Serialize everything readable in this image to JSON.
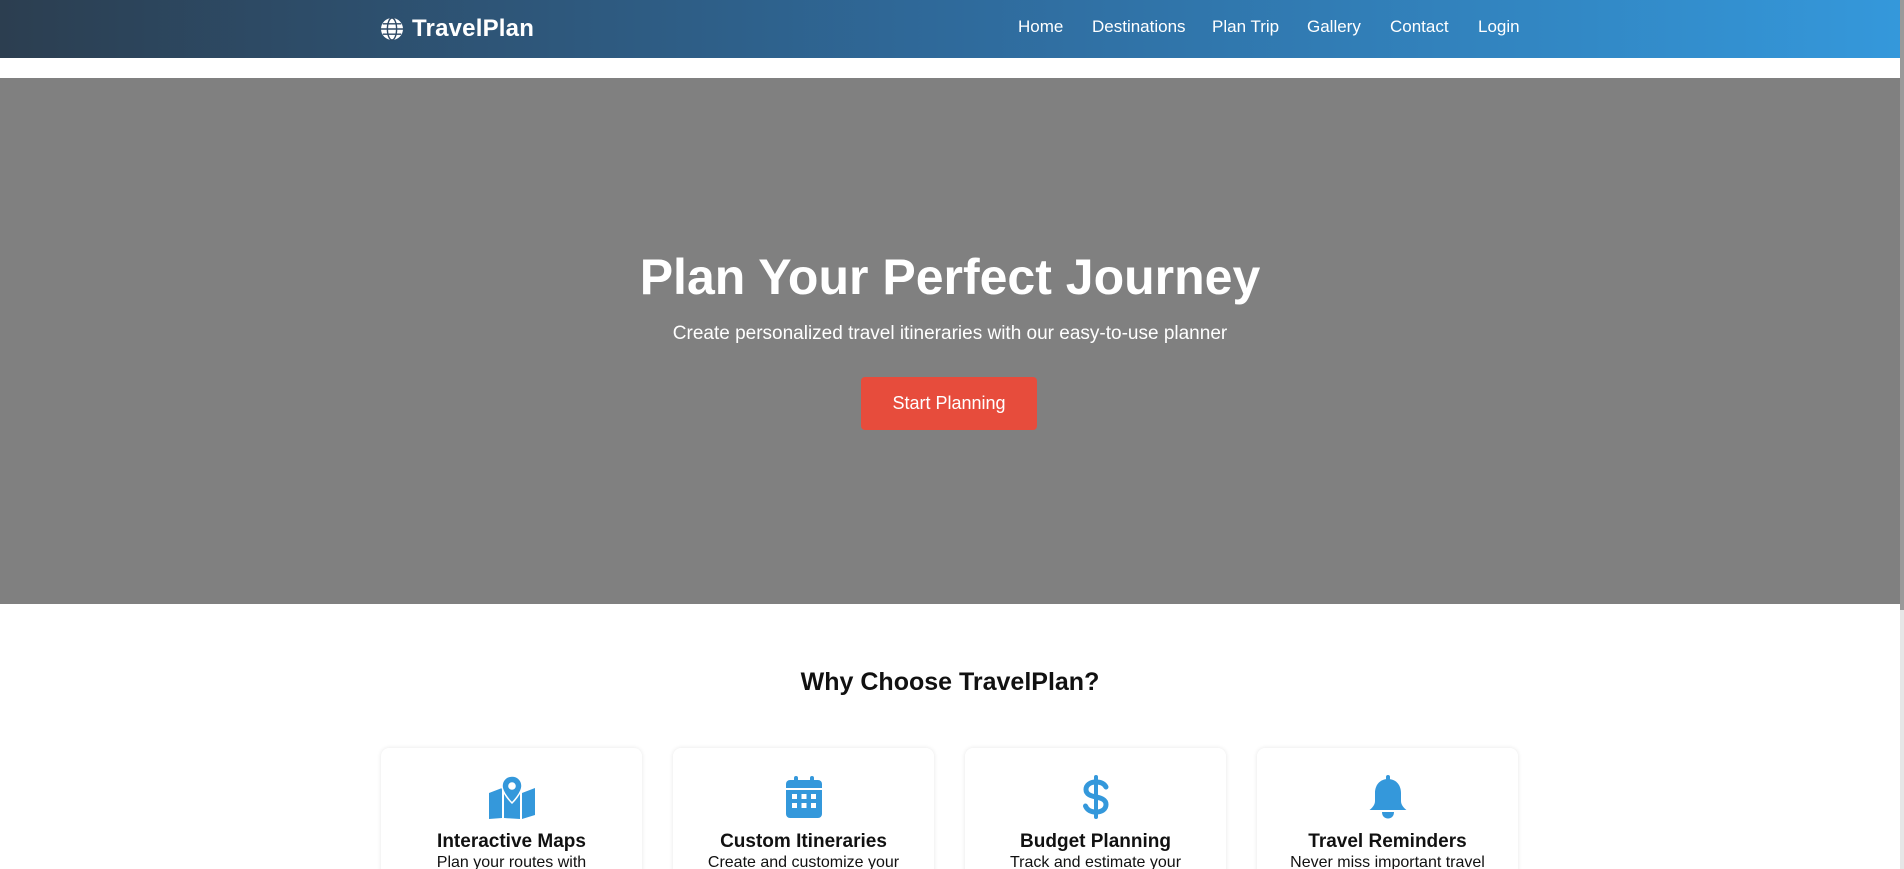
{
  "brand": {
    "name": "TravelPlan",
    "icon": "globe-icon"
  },
  "nav": [
    {
      "label": "Home",
      "name": "nav-home"
    },
    {
      "label": "Destinations",
      "name": "nav-destinations"
    },
    {
      "label": "Plan Trip",
      "name": "nav-plan-trip"
    },
    {
      "label": "Gallery",
      "name": "nav-gallery"
    },
    {
      "label": "Contact",
      "name": "nav-contact"
    },
    {
      "label": "Login",
      "name": "nav-login"
    }
  ],
  "hero": {
    "title": "Plan Your Perfect Journey",
    "subtitle": "Create personalized travel itineraries with our easy-to-use planner",
    "cta_label": "Start Planning"
  },
  "features": {
    "title": "Why Choose TravelPlan?",
    "items": [
      {
        "icon": "map-location-icon",
        "title": "Interactive Maps",
        "desc": "Plan your routes with"
      },
      {
        "icon": "calendar-icon",
        "title": "Custom Itineraries",
        "desc": "Create and customize your"
      },
      {
        "icon": "dollar-icon",
        "title": "Budget Planning",
        "desc": "Track and estimate your"
      },
      {
        "icon": "bell-icon",
        "title": "Travel Reminders",
        "desc": "Never miss important travel"
      }
    ]
  },
  "colors": {
    "header_gradient_start": "#2c3e50",
    "header_gradient_end": "#3498db",
    "hero_bg": "#808080",
    "cta_bg": "#e74c3c",
    "icon_color": "#3498db"
  }
}
